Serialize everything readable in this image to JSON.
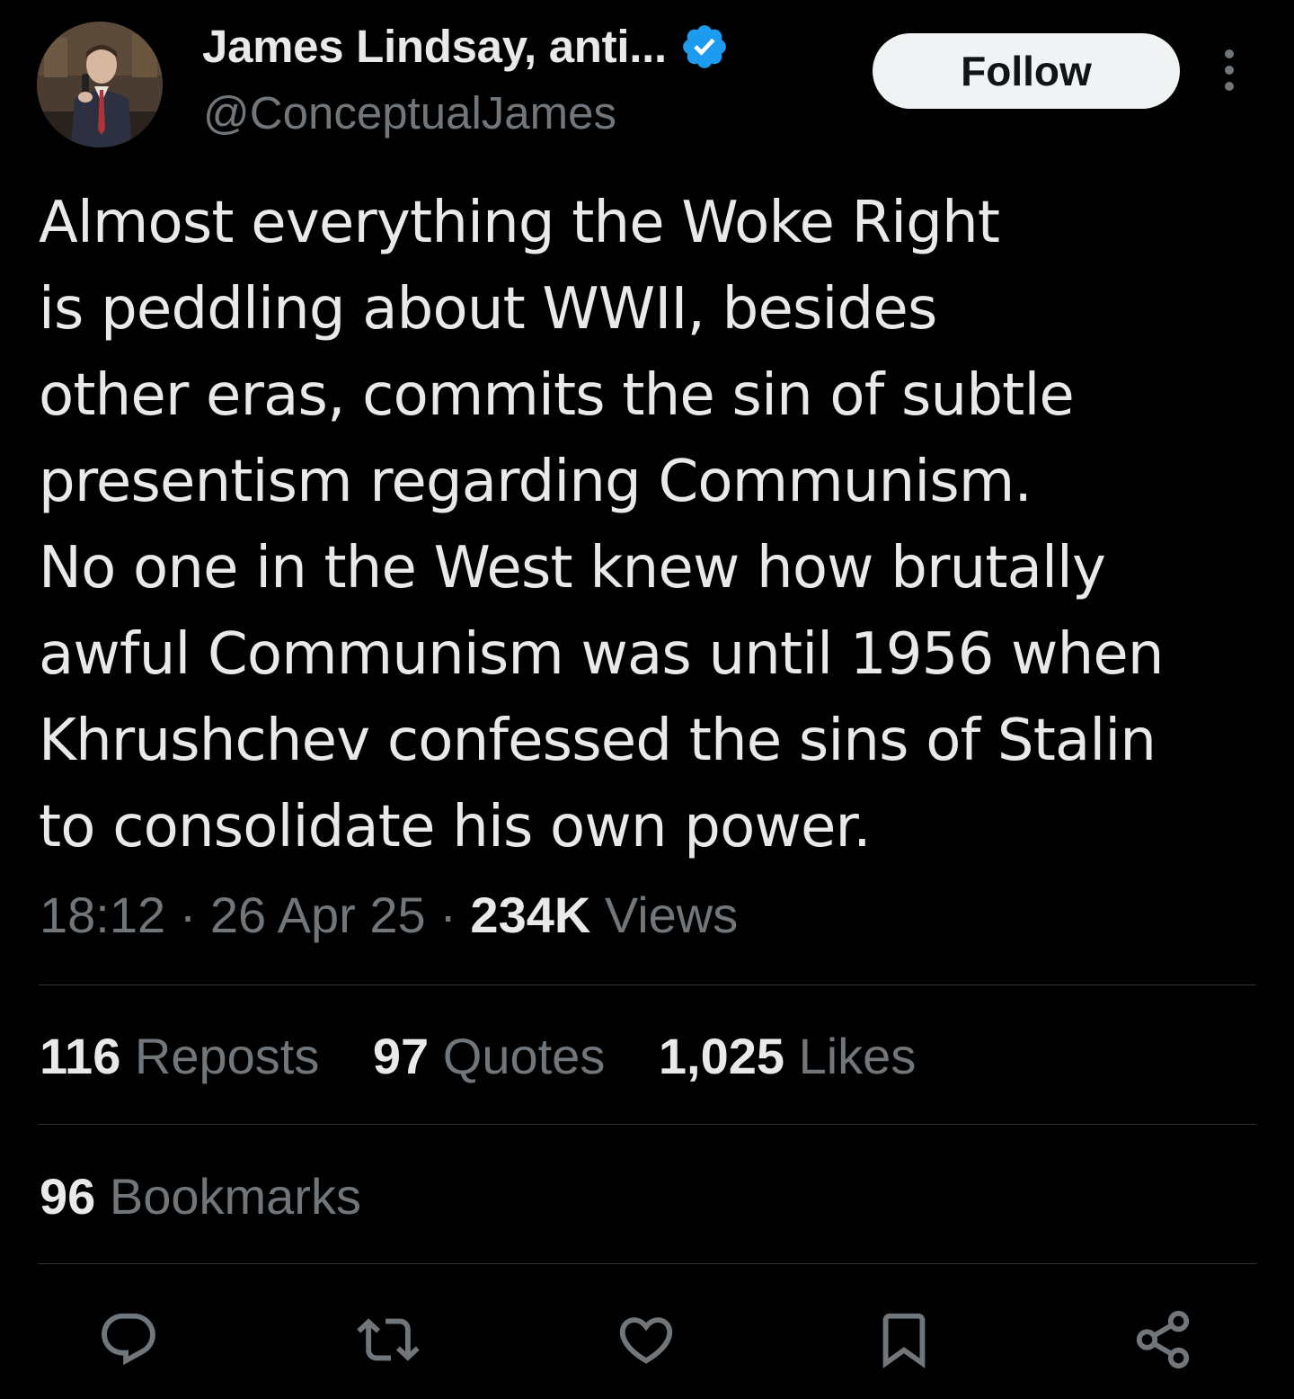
{
  "author": {
    "display_name": "James Lindsay, anti...",
    "handle": "@ConceptualJames",
    "verified": true,
    "verified_color": "#1d9bf0"
  },
  "header": {
    "follow_label": "Follow",
    "more_icon": "more-vertical-icon"
  },
  "tweet": {
    "text": "Almost everything the Woke Right\nis peddling about WWII, besides\nother eras, commits the sin of subtle\npresentism regarding Communism.\nNo one in the West knew how brutally\nawful Communism was until 1956 when\nKhrushchev confessed the sins of Stalin\nto consolidate his own power."
  },
  "meta": {
    "time": "18:12",
    "separator": " · ",
    "date": "26 Apr 25",
    "views_count": "234K",
    "views_label": "Views"
  },
  "stats": {
    "reposts": {
      "count": "116",
      "label": "Reposts"
    },
    "quotes": {
      "count": "97",
      "label": "Quotes"
    },
    "likes": {
      "count": "1,025",
      "label": "Likes"
    },
    "bookmarks": {
      "count": "96",
      "label": "Bookmarks"
    }
  },
  "actions": [
    "reply-icon",
    "repost-icon",
    "like-icon",
    "bookmark-icon",
    "share-icon"
  ],
  "colors": {
    "background": "#000000",
    "text_primary": "#e7e9ea",
    "text_secondary": "#71767b",
    "divider": "#2f3336",
    "follow_bg": "#eff3f4"
  }
}
